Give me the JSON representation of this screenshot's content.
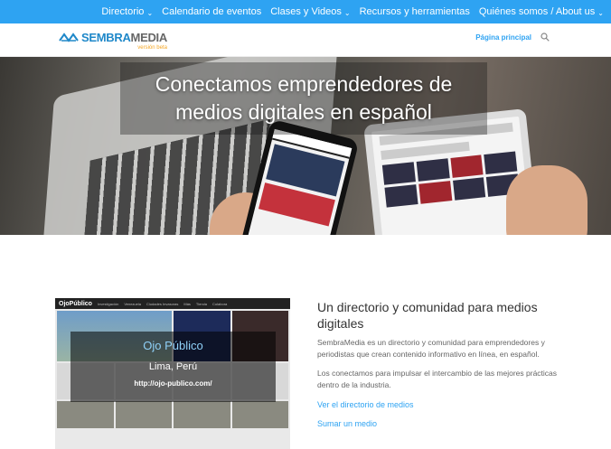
{
  "topnav": {
    "items": [
      {
        "label": "Directorio",
        "has_dropdown": true
      },
      {
        "label": "Calendario de eventos",
        "has_dropdown": false
      },
      {
        "label": "Clases y Videos",
        "has_dropdown": true
      },
      {
        "label": "Recursos y herramientas",
        "has_dropdown": false
      },
      {
        "label": "Quiénes somos / About us",
        "has_dropdown": true
      }
    ],
    "chevron": "⌄"
  },
  "header": {
    "logo_sembra": "SEMBRA",
    "logo_media": "MEDIA",
    "logo_sub": "versión beta",
    "home_link": "Página principal",
    "search_icon": "search-icon"
  },
  "hero": {
    "title": "Conectamos emprendedores de medios digitales en español"
  },
  "feature": {
    "screenshot": {
      "brand": "OjoPúblico",
      "menu": [
        "Investigación",
        "Venezuela",
        "Ciudades Invasoras",
        "Más",
        "Tienda",
        "Colabora"
      ],
      "overlay_title": "Ojo Público",
      "overlay_city": "Lima, Perú",
      "overlay_url": "http://ojo-publico.com/"
    },
    "heading": "Un directorio y comunidad para medios digitales",
    "paragraph1": "SembraMedia es un directorio y comunidad para emprendedores y periodistas que crean contenido informativo en línea, en español.",
    "paragraph2": "Los conectamos para impulsar el intercambio de las mejores prácticas dentro de la industria.",
    "link1": "Ver el directorio de medios",
    "link2": "Sumar un medio"
  },
  "colors": {
    "accent": "#2ea3f2",
    "logo_blue": "#1f88c9",
    "logo_orange": "#f5a623"
  }
}
